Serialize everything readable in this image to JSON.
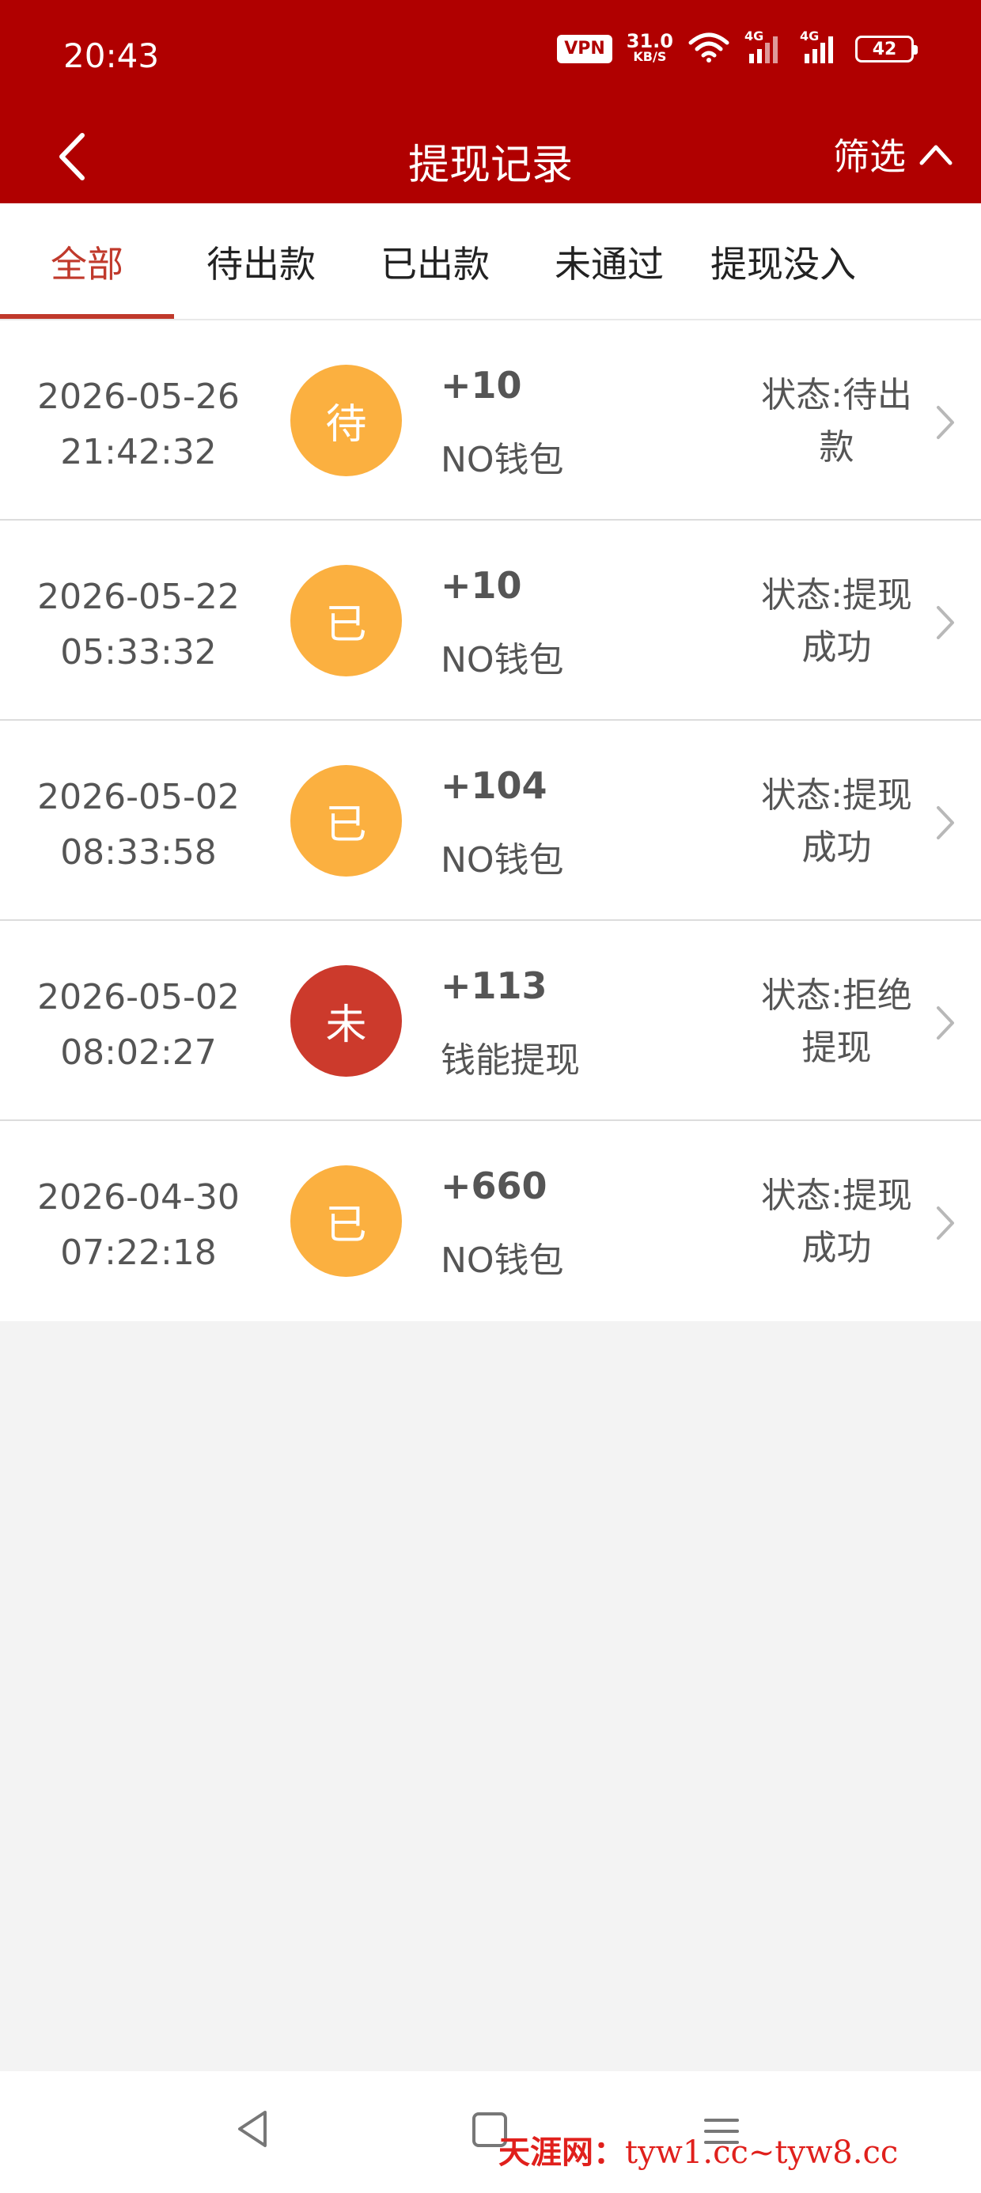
{
  "status_bar": {
    "time": "20:43",
    "vpn": "VPN",
    "speed_value": "31.0",
    "speed_unit": "KB/S",
    "net_1": "4G",
    "net_2": "4G",
    "battery": "42"
  },
  "nav": {
    "title": "提现记录",
    "filter_label": "筛选"
  },
  "tabs": [
    {
      "label": "全部",
      "active": true
    },
    {
      "label": "待出款",
      "active": false
    },
    {
      "label": "已出款",
      "active": false
    },
    {
      "label": "未通过",
      "active": false
    },
    {
      "label": "提现没入",
      "active": false
    }
  ],
  "records": [
    {
      "date": "2026-05-26",
      "time": "21:42:32",
      "badge": "待",
      "badge_color": "#fbb040",
      "amount": "+10",
      "wallet": "NO钱包",
      "status_line1": "状态:待出",
      "status_line2": "款"
    },
    {
      "date": "2026-05-22",
      "time": "05:33:32",
      "badge": "已",
      "badge_color": "#fbb040",
      "amount": "+10",
      "wallet": "NO钱包",
      "status_line1": "状态:提现",
      "status_line2": "成功"
    },
    {
      "date": "2026-05-02",
      "time": "08:33:58",
      "badge": "已",
      "badge_color": "#fbb040",
      "amount": "+104",
      "wallet": "NO钱包",
      "status_line1": "状态:提现",
      "status_line2": "成功"
    },
    {
      "date": "2026-05-02",
      "time": "08:02:27",
      "badge": "未",
      "badge_color": "#cc3a2c",
      "amount": "+113",
      "wallet": "钱能提现",
      "status_line1": "状态:拒绝",
      "status_line2": "提现"
    },
    {
      "date": "2026-04-30",
      "time": "07:22:18",
      "badge": "已",
      "badge_color": "#fbb040",
      "amount": "+660",
      "wallet": "NO钱包",
      "status_line1": "状态:提现",
      "status_line2": "成功"
    }
  ],
  "watermark": {
    "brand": "天涯网：",
    "domains": "tyw1.cc~tyw8.cc"
  },
  "colors": {
    "header_bg": "#b00000",
    "accent": "#c0392b",
    "pending": "#fbb040",
    "rejected": "#cc3a2c"
  }
}
